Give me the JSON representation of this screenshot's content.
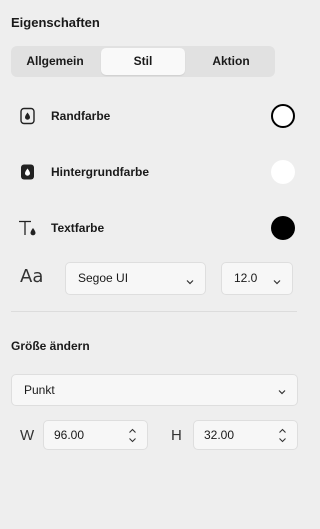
{
  "panel": {
    "title": "Eigenschaften"
  },
  "tabs": [
    {
      "label": "Allgemein",
      "active": false
    },
    {
      "label": "Stil",
      "active": true
    },
    {
      "label": "Aktion",
      "active": false
    }
  ],
  "style": {
    "border_color": {
      "label": "Randfarbe",
      "icon": "drop-outline-icon",
      "value_color": "#ffffff",
      "ring_color": "#000000"
    },
    "background_color": {
      "label": "Hintergrundfarbe",
      "icon": "drop-filled-icon",
      "value_color": "#ffffff"
    },
    "text_color": {
      "label": "Textfarbe",
      "icon": "text-color-icon",
      "value_color": "#000000"
    },
    "font": {
      "icon": "font-icon",
      "icon_text": "Aa",
      "family": "Segoe UI",
      "size": "12.0"
    }
  },
  "resize": {
    "title": "Größe ändern",
    "unit": "Punkt",
    "width_label": "W",
    "width_value": "96.00",
    "height_label": "H",
    "height_value": "32.00"
  }
}
